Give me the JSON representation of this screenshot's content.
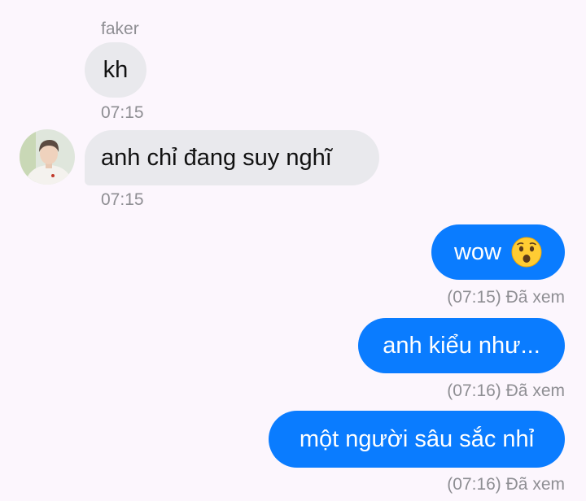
{
  "conversation": {
    "sender_name": "faker",
    "messages": [
      {
        "direction": "incoming",
        "text": "kh",
        "time": "07:15"
      },
      {
        "direction": "incoming",
        "text": "anh chỉ đang suy nghĩ",
        "time": "07:15"
      },
      {
        "direction": "outgoing",
        "text": "wow",
        "emoji": "hushed-face-emoji",
        "status": "(07:15) Đã xem"
      },
      {
        "direction": "outgoing",
        "text": "anh kiểu như...",
        "status": "(07:16) Đã xem"
      },
      {
        "direction": "outgoing",
        "text": "một người sâu sắc nhỉ",
        "status": "(07:16) Đã xem"
      }
    ]
  },
  "colors": {
    "background": "#fcf6fd",
    "incoming_bubble": "#e9e9ed",
    "outgoing_bubble": "#0a7cff",
    "meta_text": "#8e8e93"
  }
}
